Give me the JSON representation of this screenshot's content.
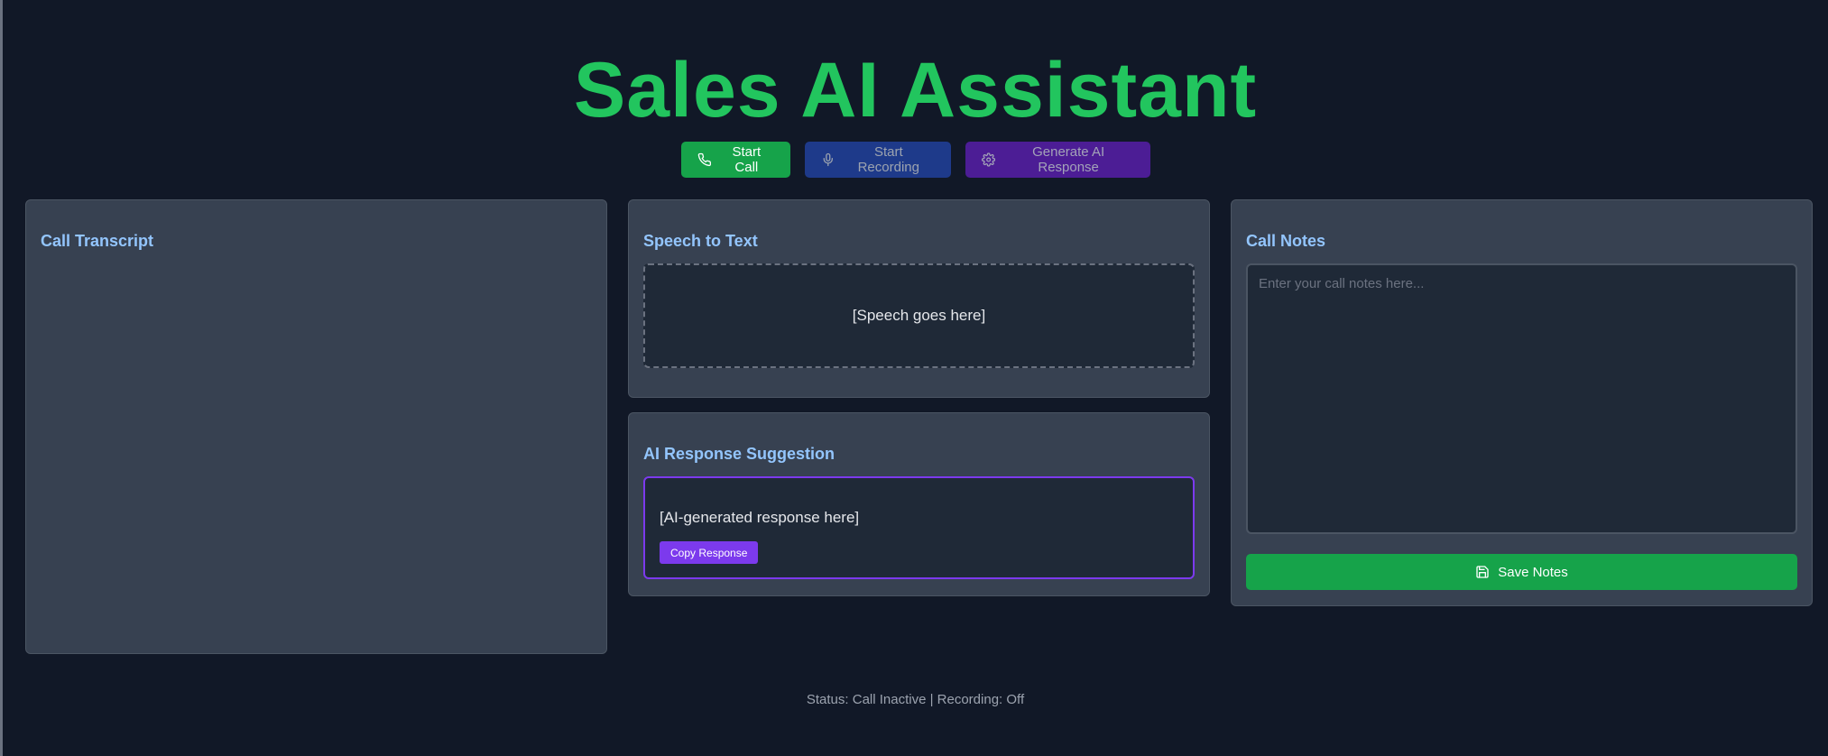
{
  "header": {
    "title": "Sales AI Assistant"
  },
  "toolbar": {
    "start_call": {
      "label": "Start Call",
      "icon": "phone-icon"
    },
    "start_recording": {
      "label": "Start Recording",
      "icon": "microphone-icon"
    },
    "generate_response": {
      "label": "Generate AI Response",
      "icon": "gear-icon"
    }
  },
  "transcript": {
    "title": "Call Transcript"
  },
  "speech": {
    "title": "Speech to Text",
    "placeholder_text": "[Speech goes here]"
  },
  "ai_response": {
    "title": "AI Response Suggestion",
    "text": "[AI-generated response here]",
    "copy_label": "Copy Response"
  },
  "notes": {
    "title": "Call Notes",
    "placeholder": "Enter your call notes here...",
    "value": "",
    "save_label": "Save Notes",
    "save_icon": "save-icon"
  },
  "status": {
    "text": "Status: Call Inactive | Recording: Off"
  },
  "colors": {
    "background": "#111827",
    "panel": "#374151",
    "title_green": "#22c55e",
    "panel_title_blue": "#93c5fd",
    "call_green": "#16a34a",
    "record_blue": "#1e3a8a",
    "generate_purple": "#4c1d95",
    "accent_purple": "#7c3aed"
  }
}
